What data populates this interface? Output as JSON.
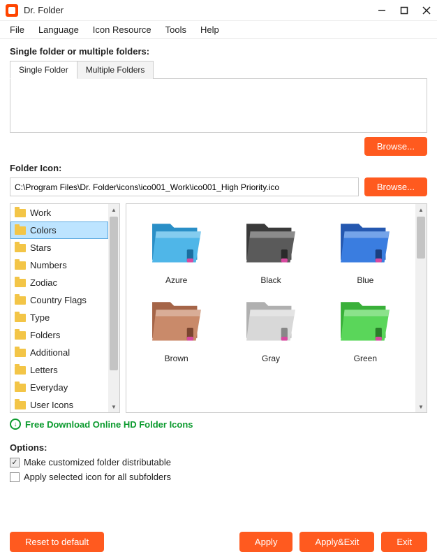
{
  "titlebar": {
    "title": "Dr. Folder"
  },
  "menu": {
    "items": [
      "File",
      "Language",
      "Icon Resource",
      "Tools",
      "Help"
    ]
  },
  "single_section": {
    "label": "Single folder or multiple folders:",
    "tabs": [
      "Single Folder",
      "Multiple Folders"
    ],
    "active_tab": 0,
    "browse": "Browse..."
  },
  "folder_icon": {
    "label": "Folder Icon:",
    "path": "C:\\Program Files\\Dr. Folder\\icons\\ico001_Work\\ico001_High Priority.ico",
    "browse": "Browse..."
  },
  "categories": [
    "Work",
    "Colors",
    "Stars",
    "Numbers",
    "Zodiac",
    "Country Flags",
    "Type",
    "Folders",
    "Additional",
    "Letters",
    "Everyday",
    "User Icons"
  ],
  "selected_category": 1,
  "icons": [
    {
      "label": "Azure",
      "fill": "#4fb6e8",
      "shade": "#2a8fc7",
      "tab": "#1a6ea0"
    },
    {
      "label": "Black",
      "fill": "#5a5a5a",
      "shade": "#3a3a3a",
      "tab": "#2a2a2a"
    },
    {
      "label": "Blue",
      "fill": "#3a7de0",
      "shade": "#2558b0",
      "tab": "#1a3f80"
    },
    {
      "label": "Brown",
      "fill": "#c98a6a",
      "shade": "#a56548",
      "tab": "#7a4530"
    },
    {
      "label": "Gray",
      "fill": "#d8d8d8",
      "shade": "#b0b0b0",
      "tab": "#888888"
    },
    {
      "label": "Green",
      "fill": "#5ad65a",
      "shade": "#3ab03a",
      "tab": "#2a802a"
    }
  ],
  "download_link": "Free Download Online HD Folder Icons",
  "options": {
    "label": "Options:",
    "opt1": {
      "label": "Make customized folder distributable",
      "checked": true
    },
    "opt2": {
      "label": "Apply selected icon for all subfolders",
      "checked": false
    }
  },
  "buttons": {
    "reset": "Reset to default",
    "apply": "Apply",
    "apply_exit": "Apply&Exit",
    "exit": "Exit"
  }
}
